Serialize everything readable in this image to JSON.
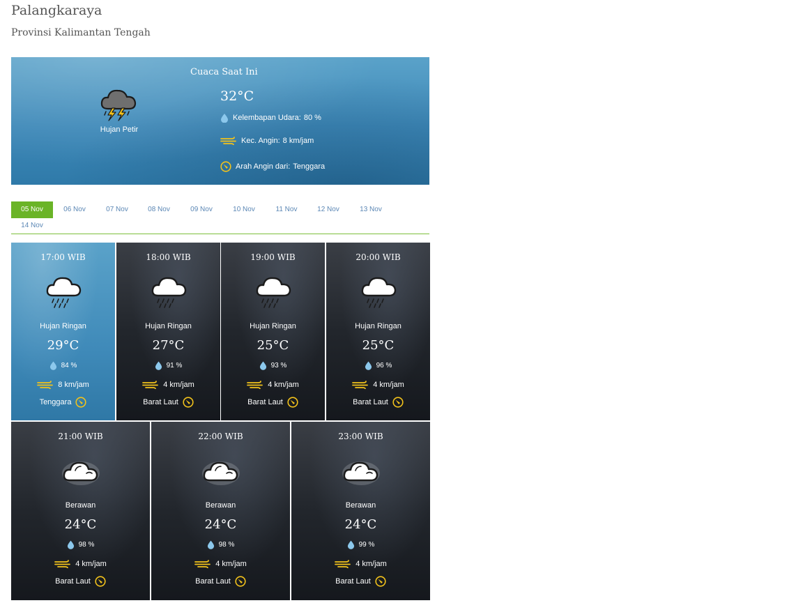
{
  "location": {
    "city": "Palangkaraya",
    "province": "Provinsi Kalimantan Tengah"
  },
  "current": {
    "title": "Cuaca Saat Ini",
    "icon": "thunderstorm-icon",
    "condition": "Hujan Petir",
    "temperature": "32°C",
    "humidity_label": "Kelembapan Udara:",
    "humidity_value": "80 %",
    "wind_label": "Kec. Angin:",
    "wind_value": "8 km/jam",
    "direction_label": "Arah Angin dari:",
    "direction_value": "Tenggara"
  },
  "tabs": [
    {
      "label": "05 Nov",
      "active": true
    },
    {
      "label": "06 Nov",
      "active": false
    },
    {
      "label": "07 Nov",
      "active": false
    },
    {
      "label": "08 Nov",
      "active": false
    },
    {
      "label": "09 Nov",
      "active": false
    },
    {
      "label": "10 Nov",
      "active": false
    },
    {
      "label": "11 Nov",
      "active": false
    },
    {
      "label": "12 Nov",
      "active": false
    },
    {
      "label": "13 Nov",
      "active": false
    },
    {
      "label": "14 Nov",
      "active": false
    }
  ],
  "forecast": [
    {
      "time": "17:00 WIB",
      "icon": "light-rain-icon",
      "condition": "Hujan Ringan",
      "temperature": "29°C",
      "humidity": "84 %",
      "wind": "8 km/jam",
      "direction": "Tenggara"
    },
    {
      "time": "18:00 WIB",
      "icon": "light-rain-icon",
      "condition": "Hujan Ringan",
      "temperature": "27°C",
      "humidity": "91 %",
      "wind": "4 km/jam",
      "direction": "Barat Laut"
    },
    {
      "time": "19:00 WIB",
      "icon": "light-rain-icon",
      "condition": "Hujan Ringan",
      "temperature": "25°C",
      "humidity": "93 %",
      "wind": "4 km/jam",
      "direction": "Barat Laut"
    },
    {
      "time": "20:00 WIB",
      "icon": "light-rain-icon",
      "condition": "Hujan Ringan",
      "temperature": "25°C",
      "humidity": "96 %",
      "wind": "4 km/jam",
      "direction": "Barat Laut"
    },
    {
      "time": "21:00 WIB",
      "icon": "cloudy-icon",
      "condition": "Berawan",
      "temperature": "24°C",
      "humidity": "98 %",
      "wind": "4 km/jam",
      "direction": "Barat Laut"
    },
    {
      "time": "22:00 WIB",
      "icon": "cloudy-icon",
      "condition": "Berawan",
      "temperature": "24°C",
      "humidity": "98 %",
      "wind": "4 km/jam",
      "direction": "Barat Laut"
    },
    {
      "time": "23:00 WIB",
      "icon": "cloudy-icon",
      "condition": "Berawan",
      "temperature": "24°C",
      "humidity": "99 %",
      "wind": "4 km/jam",
      "direction": "Barat Laut"
    }
  ],
  "colors": {
    "accent_green": "#6ab427",
    "tab_text": "#5b87b5",
    "wind_yellow": "#f2c21b",
    "drop_blue": "#8cc8ec"
  }
}
